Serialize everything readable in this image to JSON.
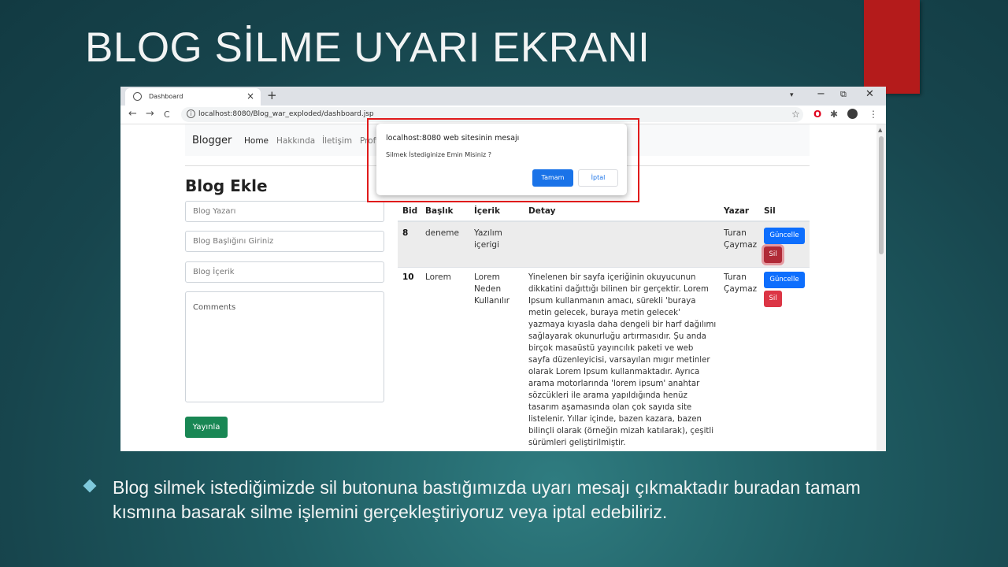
{
  "slide": {
    "title": "BLOG SİLME UYARI EKRANI",
    "bullet": "Blog silmek istediğimizde sil butonuna bastığımızda uyarı mesajı çıkmaktadır buradan tamam kısmına basarak silme işlemini gerçekleştiriyoruz veya iptal edebiliriz.",
    "accent_color": "#b41b1b"
  },
  "browser": {
    "tab_title": "Dashboard",
    "tab_close": "×",
    "new_tab": "+",
    "url": "localhost:8080/Blog_war_exploded/dashboard.jsp",
    "controls": {
      "minimize": "−",
      "restore": "⧉",
      "close": "✕"
    },
    "nav": {
      "back": "←",
      "forward": "→",
      "reload": "C"
    },
    "icons": {
      "star": "☆",
      "opera": "O",
      "puzzle": "✱",
      "menu": "⋮",
      "dropdown": "▾"
    }
  },
  "navbar": {
    "brand": "Blogger",
    "links": [
      "Home",
      "Hakkında",
      "İletişim",
      "Profil"
    ]
  },
  "form": {
    "title": "Blog Ekle",
    "author_placeholder": "Blog Yazarı",
    "title_placeholder": "Blog Başlığını Giriniz",
    "content_placeholder": "Blog İçerik",
    "comments_placeholder": "Comments",
    "submit_label": "Yayınla"
  },
  "table": {
    "headers": [
      "Bid",
      "Başlık",
      "İçerik",
      "Detay",
      "Yazar",
      "Sil"
    ],
    "rows": [
      {
        "bid": "8",
        "title": "deneme",
        "content": "Yazılım içerigi",
        "detail": "",
        "author": "Turan Çaymaz",
        "update_label": "Güncelle",
        "delete_label": "Sil"
      },
      {
        "bid": "10",
        "title": "Lorem",
        "content": "Lorem Neden Kullanılır",
        "detail": "Yinelenen bir sayfa içeriğinin okuyucunun dikkatini dağıttığı bilinen bir gerçektir. Lorem Ipsum kullanmanın amacı, sürekli 'buraya metin gelecek, buraya metin gelecek' yazmaya kıyasla daha dengeli bir harf dağılımı sağlayarak okunurluğu artırmasıdır. Şu anda birçok masaüstü yayıncılık paketi ve web sayfa düzenleyicisi, varsayılan mıgır metinler olarak Lorem Ipsum kullanmaktadır. Ayrıca arama motorlarında 'lorem ipsum' anahtar sözcükleri ile arama yapıldığında henüz tasarım aşamasında olan çok sayıda site listelenir. Yıllar içinde, bazen kazara, bazen bilinçli olarak (örneğin mizah katılarak), çeşitli sürümleri geliştirilmiştir.",
        "author": "Turan Çaymaz",
        "update_label": "Güncelle",
        "delete_label": "Sil"
      }
    ]
  },
  "dialog": {
    "title": "localhost:8080 web sitesinin mesajı",
    "message": "Silmek İstediginize Emin Misiniz ?",
    "ok_label": "Tamam",
    "cancel_label": "İptal"
  }
}
